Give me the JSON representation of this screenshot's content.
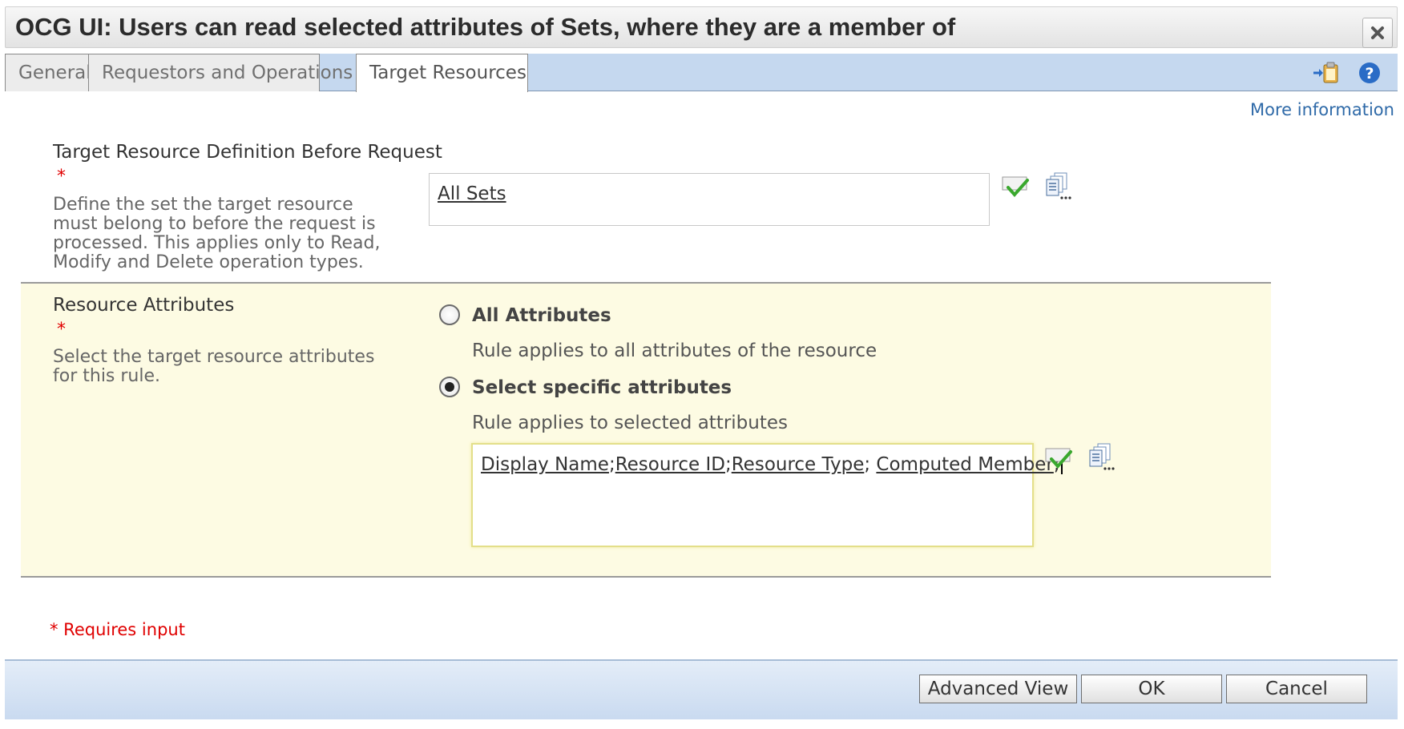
{
  "window": {
    "title": "OCG UI: Users can read selected attributes of Sets, where they are a member of",
    "close_icon": "close-icon"
  },
  "tabs": [
    {
      "label": "General",
      "active": false
    },
    {
      "label": "Requestors and Operations",
      "active": false
    },
    {
      "label": "Target Resources",
      "active": true
    }
  ],
  "toolbar": {
    "icons": [
      "paste-icon",
      "help-icon"
    ],
    "more_information": "More information"
  },
  "target_resource": {
    "label": "Target Resource Definition Before Request",
    "required_marker": "*",
    "description": "Define the set the target resource must belong to before the request is processed. This applies only to Read, Modify and Delete operation types.",
    "value": "All Sets",
    "icons": [
      "validate-check-icon",
      "browse-icon"
    ]
  },
  "resource_attributes": {
    "label": "Resource Attributes",
    "required_marker": "*",
    "description": "Select the target resource attributes for this rule.",
    "options": [
      {
        "label": "All Attributes",
        "description": "Rule applies to all attributes of the resource",
        "checked": false
      },
      {
        "label": "Select specific attributes",
        "description": "Rule applies to selected attributes",
        "checked": true
      }
    ],
    "selected_attributes": [
      "Display Name",
      "Resource ID",
      "Resource Type",
      "Computed Member"
    ],
    "icons": [
      "validate-check-icon",
      "browse-icon"
    ]
  },
  "footer": {
    "requires_input": "* Requires input",
    "buttons": {
      "advanced_view": "Advanced View",
      "ok": "OK",
      "cancel": "Cancel"
    }
  },
  "colors": {
    "tab_bar": "#c5d8ef",
    "section_highlight": "#fdfbe3",
    "link": "#2f6aa8",
    "required": "#e00000"
  }
}
